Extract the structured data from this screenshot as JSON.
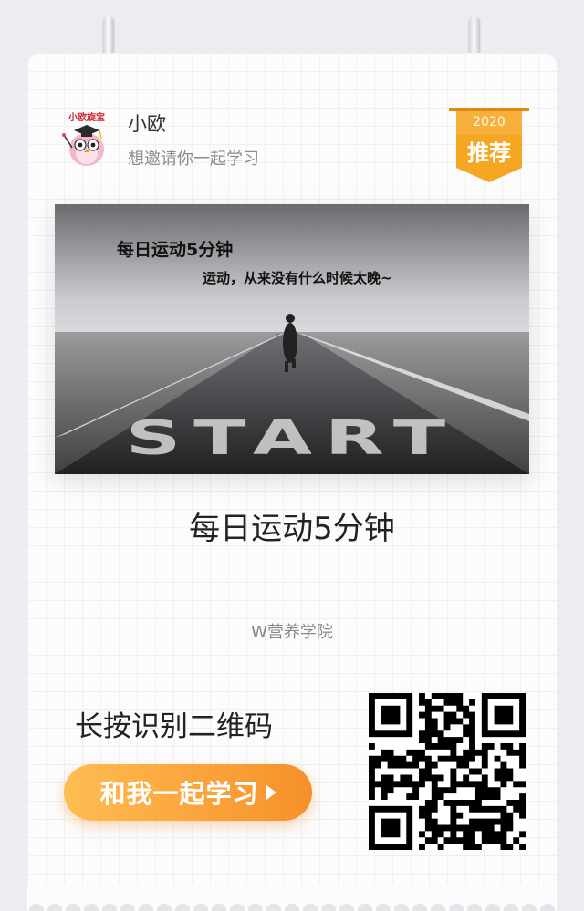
{
  "profile": {
    "avatar_caption": "小欧旋宝",
    "name": "小欧",
    "invite_text": "想邀请你一起学习"
  },
  "badge": {
    "year": "2020",
    "label": "推荐"
  },
  "banner": {
    "headline": "每日运动5分钟",
    "subline": "运动，从来没有什么时候太晚~",
    "road_text": "START"
  },
  "course": {
    "title": "每日运动5分钟",
    "organization": "W营养学院"
  },
  "footer": {
    "scan_prompt": "长按识别二维码",
    "cta_label": "和我一起学习"
  },
  "colors": {
    "accent_orange": "#f6902a",
    "accent_light": "#ffbd52",
    "badge_gold": "#f5a623"
  },
  "icons": {
    "cta_arrow": "play-triangle-icon",
    "qr": "qr-code"
  }
}
